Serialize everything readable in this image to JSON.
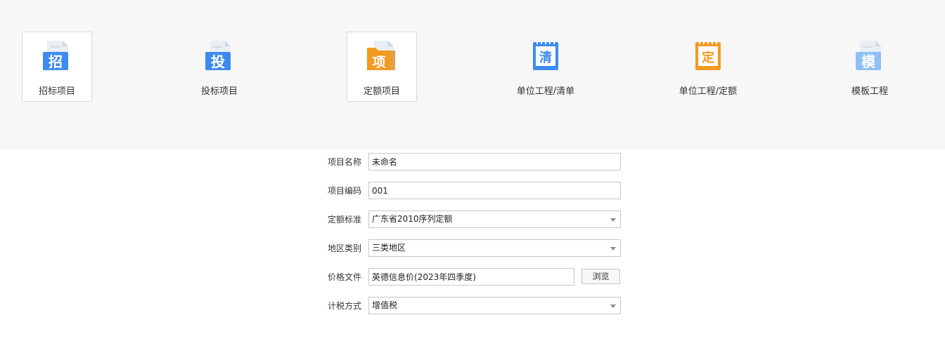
{
  "toolbar": {
    "items": [
      {
        "label": "招标项目",
        "icon_char": "招",
        "icon": "document-zhao-icon",
        "color": "#3d8bef"
      },
      {
        "label": "投标项目",
        "icon_char": "投",
        "icon": "document-tou-icon",
        "color": "#3d8bef"
      },
      {
        "label": "定额项目",
        "icon_char": "项",
        "icon": "folder-xiang-icon",
        "color": "#f39a21"
      },
      {
        "label": "单位工程/清单",
        "icon_char": "清",
        "icon": "notepad-qing-icon",
        "color": "#3d8bef"
      },
      {
        "label": "单位工程/定额",
        "icon_char": "定",
        "icon": "notepad-ding-icon",
        "color": "#f39a21"
      },
      {
        "label": "模板工程",
        "icon_char": "模",
        "icon": "document-mo-icon",
        "color": "#8fc0f5"
      }
    ]
  },
  "form": {
    "project_name": {
      "label": "项目名称",
      "value": "未命名"
    },
    "project_code": {
      "label": "项目编码",
      "value": "001"
    },
    "quota_standard": {
      "label": "定额标准",
      "value": "广东省2010序列定额"
    },
    "region_type": {
      "label": "地区类别",
      "value": "三类地区"
    },
    "price_file": {
      "label": "价格文件",
      "value": "英德信息价(2023年四季度)",
      "browse_label": "浏览"
    },
    "tax_method": {
      "label": "计税方式",
      "value": "增值税"
    }
  }
}
